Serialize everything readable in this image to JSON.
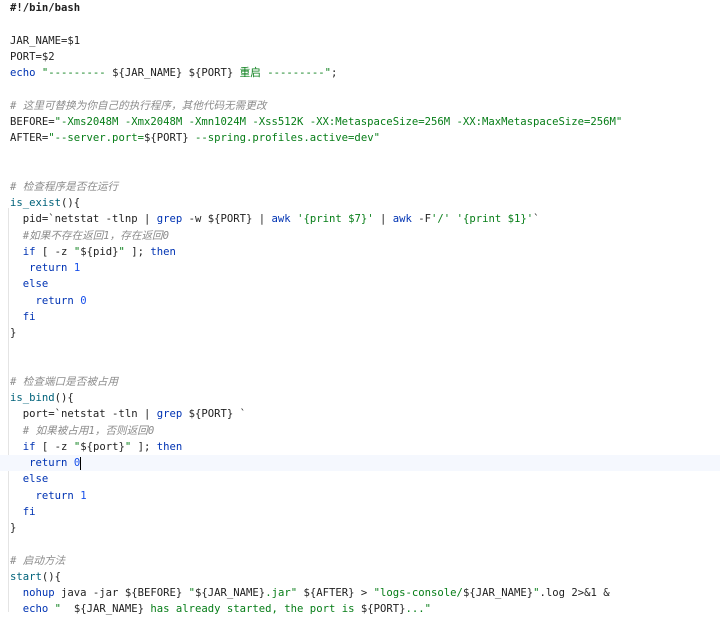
{
  "editor": {
    "lines": [
      {
        "tokens": [
          {
            "t": "#!/bin/bash",
            "c": "kw-shebang"
          }
        ]
      },
      {
        "tokens": []
      },
      {
        "tokens": [
          {
            "t": "JAR_NAME=$1",
            "c": "var"
          }
        ]
      },
      {
        "tokens": [
          {
            "t": "PORT=$2",
            "c": "var"
          }
        ]
      },
      {
        "tokens": [
          {
            "t": "echo ",
            "c": "kw"
          },
          {
            "t": "\"--------- ",
            "c": "str"
          },
          {
            "t": "${JAR_NAME}",
            "c": "var"
          },
          {
            "t": " ",
            "c": "str"
          },
          {
            "t": "${PORT}",
            "c": "var"
          },
          {
            "t": " 重启 ---------\"",
            "c": "str"
          },
          {
            "t": ";",
            "c": "var"
          }
        ]
      },
      {
        "tokens": []
      },
      {
        "tokens": [
          {
            "t": "# 这里可替换为你自己的执行程序，其他代码无需更改",
            "c": "cmt"
          }
        ]
      },
      {
        "tokens": [
          {
            "t": "BEFORE=",
            "c": "var"
          },
          {
            "t": "\"-Xms2048M -Xmx2048M -Xmn1024M -Xss512K -XX:MetaspaceSize=256M -XX:MaxMetaspaceSize=256M\"",
            "c": "str"
          }
        ]
      },
      {
        "tokens": [
          {
            "t": "AFTER=",
            "c": "var"
          },
          {
            "t": "\"--server.port=",
            "c": "str"
          },
          {
            "t": "${PORT}",
            "c": "var"
          },
          {
            "t": " --spring.profiles.active=dev\"",
            "c": "str"
          }
        ]
      },
      {
        "tokens": []
      },
      {
        "tokens": []
      },
      {
        "tokens": [
          {
            "t": "# 检查程序是否在运行",
            "c": "cmt"
          }
        ]
      },
      {
        "tokens": [
          {
            "t": "is_exist",
            "c": "fn"
          },
          {
            "t": "(){",
            "c": "var"
          }
        ]
      },
      {
        "tokens": [
          {
            "t": "  pid=",
            "c": "var"
          },
          {
            "t": "`netstat -tlnp | ",
            "c": "var"
          },
          {
            "t": "grep",
            "c": "kw"
          },
          {
            "t": " -w ",
            "c": "var"
          },
          {
            "t": "${PORT}",
            "c": "var"
          },
          {
            "t": " | ",
            "c": "var"
          },
          {
            "t": "awk",
            "c": "kw"
          },
          {
            "t": " ",
            "c": "var"
          },
          {
            "t": "'{print $7}'",
            "c": "str"
          },
          {
            "t": " | ",
            "c": "var"
          },
          {
            "t": "awk",
            "c": "kw"
          },
          {
            "t": " -F",
            "c": "var"
          },
          {
            "t": "'/'",
            "c": "str"
          },
          {
            "t": " ",
            "c": "var"
          },
          {
            "t": "'{print $1}'",
            "c": "str"
          },
          {
            "t": "`",
            "c": "var"
          }
        ]
      },
      {
        "tokens": [
          {
            "t": "  #如果不存在返回1，存在返回0",
            "c": "cmt"
          }
        ]
      },
      {
        "tokens": [
          {
            "t": "  ",
            "c": "var"
          },
          {
            "t": "if",
            "c": "kw"
          },
          {
            "t": " [ -z ",
            "c": "var"
          },
          {
            "t": "\"",
            "c": "str"
          },
          {
            "t": "${pid}",
            "c": "var"
          },
          {
            "t": "\"",
            "c": "str"
          },
          {
            "t": " ]; ",
            "c": "var"
          },
          {
            "t": "then",
            "c": "kw"
          }
        ]
      },
      {
        "tokens": [
          {
            "t": "   ",
            "c": "var"
          },
          {
            "t": "return",
            "c": "kw"
          },
          {
            "t": " ",
            "c": "var"
          },
          {
            "t": "1",
            "c": "num"
          }
        ]
      },
      {
        "tokens": [
          {
            "t": "  ",
            "c": "var"
          },
          {
            "t": "else",
            "c": "kw"
          }
        ]
      },
      {
        "tokens": [
          {
            "t": "    ",
            "c": "var"
          },
          {
            "t": "return",
            "c": "kw"
          },
          {
            "t": " ",
            "c": "var"
          },
          {
            "t": "0",
            "c": "num"
          }
        ]
      },
      {
        "tokens": [
          {
            "t": "  ",
            "c": "var"
          },
          {
            "t": "fi",
            "c": "kw"
          }
        ]
      },
      {
        "tokens": [
          {
            "t": "}",
            "c": "var"
          }
        ]
      },
      {
        "tokens": []
      },
      {
        "tokens": []
      },
      {
        "tokens": [
          {
            "t": "# 检查端口是否被占用",
            "c": "cmt"
          }
        ]
      },
      {
        "tokens": [
          {
            "t": "is_bind",
            "c": "fn"
          },
          {
            "t": "(){",
            "c": "var"
          }
        ]
      },
      {
        "tokens": [
          {
            "t": "  port=",
            "c": "var"
          },
          {
            "t": "`netstat -tln | ",
            "c": "var"
          },
          {
            "t": "grep",
            "c": "kw"
          },
          {
            "t": " ",
            "c": "var"
          },
          {
            "t": "${PORT}",
            "c": "var"
          },
          {
            "t": " `",
            "c": "var"
          }
        ]
      },
      {
        "tokens": [
          {
            "t": "  # 如果被占用1，否则返回0",
            "c": "cmt"
          }
        ]
      },
      {
        "tokens": [
          {
            "t": "  ",
            "c": "var"
          },
          {
            "t": "if",
            "c": "kw"
          },
          {
            "t": " [ -z ",
            "c": "var"
          },
          {
            "t": "\"",
            "c": "str"
          },
          {
            "t": "${port}",
            "c": "var"
          },
          {
            "t": "\"",
            "c": "str"
          },
          {
            "t": " ]; ",
            "c": "var"
          },
          {
            "t": "then",
            "c": "kw"
          }
        ]
      },
      {
        "tokens": [
          {
            "t": "   ",
            "c": "var"
          },
          {
            "t": "return",
            "c": "kw"
          },
          {
            "t": " ",
            "c": "var"
          },
          {
            "t": "0",
            "c": "num"
          },
          {
            "t": "",
            "c": "caret"
          }
        ],
        "current": true
      },
      {
        "tokens": [
          {
            "t": "  ",
            "c": "var"
          },
          {
            "t": "else",
            "c": "kw"
          }
        ]
      },
      {
        "tokens": [
          {
            "t": "    ",
            "c": "var"
          },
          {
            "t": "return",
            "c": "kw"
          },
          {
            "t": " ",
            "c": "var"
          },
          {
            "t": "1",
            "c": "num"
          }
        ]
      },
      {
        "tokens": [
          {
            "t": "  ",
            "c": "var"
          },
          {
            "t": "fi",
            "c": "kw"
          }
        ]
      },
      {
        "tokens": [
          {
            "t": "}",
            "c": "var"
          }
        ]
      },
      {
        "tokens": []
      },
      {
        "tokens": [
          {
            "t": "# 启动方法",
            "c": "cmt"
          }
        ]
      },
      {
        "tokens": [
          {
            "t": "start",
            "c": "fn"
          },
          {
            "t": "(){",
            "c": "var"
          }
        ]
      },
      {
        "tokens": [
          {
            "t": "  ",
            "c": "var"
          },
          {
            "t": "nohup",
            "c": "kw"
          },
          {
            "t": " java -jar ",
            "c": "var"
          },
          {
            "t": "${BEFORE}",
            "c": "var"
          },
          {
            "t": " ",
            "c": "var"
          },
          {
            "t": "\"",
            "c": "str"
          },
          {
            "t": "${JAR_NAME}",
            "c": "var"
          },
          {
            "t": ".jar\"",
            "c": "str"
          },
          {
            "t": " ",
            "c": "var"
          },
          {
            "t": "${AFTER}",
            "c": "var"
          },
          {
            "t": " > ",
            "c": "var"
          },
          {
            "t": "\"logs-console/",
            "c": "str"
          },
          {
            "t": "${JAR_NAME}",
            "c": "var"
          },
          {
            "t": "\"",
            "c": "str"
          },
          {
            "t": ".log 2>&1 &",
            "c": "var"
          }
        ]
      },
      {
        "tokens": [
          {
            "t": "  ",
            "c": "var"
          },
          {
            "t": "echo",
            "c": "kw"
          },
          {
            "t": " ",
            "c": "var"
          },
          {
            "t": "\"  ",
            "c": "str"
          },
          {
            "t": "${JAR_NAME}",
            "c": "var"
          },
          {
            "t": " has already started, the port is ",
            "c": "str"
          },
          {
            "t": "${PORT}",
            "c": "var"
          },
          {
            "t": "...\"",
            "c": "str"
          }
        ]
      },
      {
        "tokens": [
          {
            "t": "}",
            "c": "var"
          }
        ]
      }
    ]
  }
}
